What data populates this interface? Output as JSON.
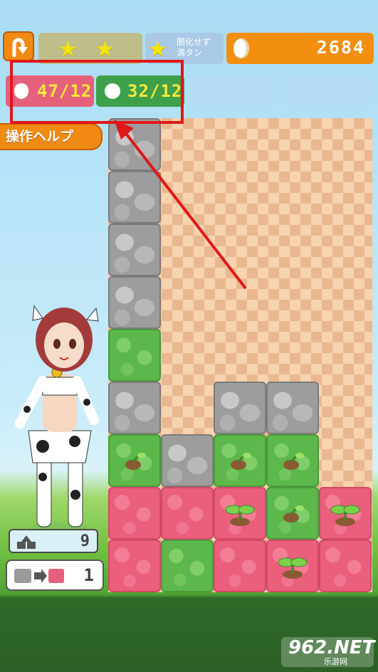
{
  "header": {
    "back_icon": "back-arrow-icon",
    "stars": [
      "★",
      "★"
    ],
    "bonus_text": "闇化せず\n満タン",
    "bonus_star": "★",
    "coins": "2684"
  },
  "goals": [
    {
      "icon": "strawberry-icon",
      "value": "47/12",
      "color": "#e5607a"
    },
    {
      "icon": "apple-icon",
      "value": "32/12",
      "color": "#3ea04a"
    }
  ],
  "help_label": "操作ヘルプ",
  "board": {
    "columns": 5,
    "rows": [
      [
        "rock",
        null,
        null,
        null,
        null
      ],
      [
        "rock",
        null,
        null,
        null,
        null
      ],
      [
        "rock",
        null,
        null,
        null,
        null
      ],
      [
        "rock",
        null,
        null,
        null,
        null
      ],
      [
        "green",
        null,
        null,
        null,
        null
      ],
      [
        "rock",
        null,
        "rock",
        "rock",
        null
      ],
      [
        "green-seed",
        "rock",
        "green-seed",
        "green-seed",
        null
      ],
      [
        "pink",
        "pink",
        "pink-sprout",
        "green-seed",
        "pink-sprout"
      ],
      [
        "pink",
        "green",
        "pink",
        "pink-sprout",
        "pink"
      ]
    ]
  },
  "side": {
    "panel1_count": "9",
    "panel2_count": "1"
  },
  "watermark": {
    "main": "962.NET",
    "sub": "乐游网"
  }
}
